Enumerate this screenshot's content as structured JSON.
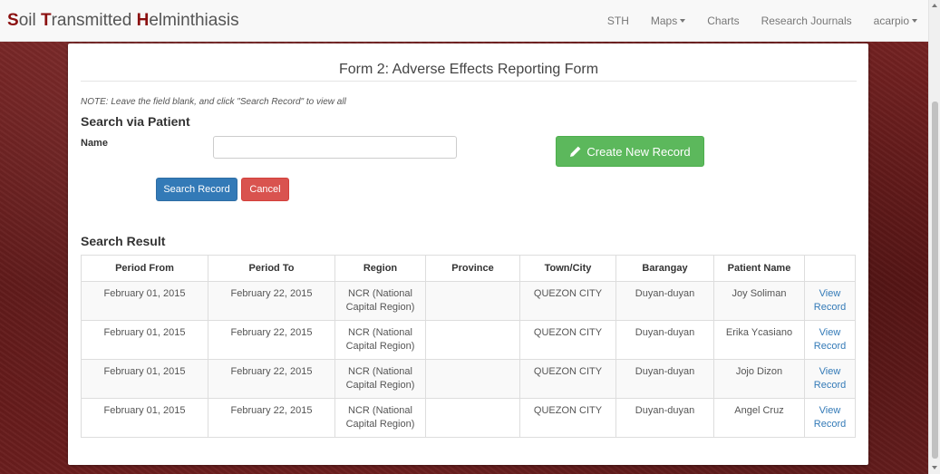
{
  "brand": {
    "parts": [
      {
        "cap": "S",
        "rest": "oil "
      },
      {
        "cap": "T",
        "rest": "ransmitted "
      },
      {
        "cap": "H",
        "rest": "elminthiasis"
      }
    ]
  },
  "nav": [
    {
      "label": "STH",
      "dropdown": false
    },
    {
      "label": "Maps",
      "dropdown": true
    },
    {
      "label": "Charts",
      "dropdown": false
    },
    {
      "label": "Research Journals",
      "dropdown": false
    },
    {
      "label": "acarpio",
      "dropdown": true
    }
  ],
  "form": {
    "title": "Form 2: Adverse Effects Reporting Form",
    "note": "NOTE: Leave the field blank, and click \"Search Record\" to view all",
    "search_heading": "Search via Patient",
    "name_label": "Name",
    "name_value": "",
    "create_label": "Create New Record",
    "search_label": "Search Record",
    "cancel_label": "Cancel"
  },
  "results": {
    "heading": "Search Result",
    "columns": [
      "Period From",
      "Period To",
      "Region",
      "Province",
      "Town/City",
      "Barangay",
      "Patient Name",
      ""
    ],
    "rows": [
      {
        "from": "February 01, 2015",
        "to": "February 22, 2015",
        "region1": "NCR (National",
        "region2": "Capital Region)",
        "province": "",
        "city": "QUEZON CITY",
        "barangay": "Duyan-duyan",
        "patient": "Joy Soliman",
        "view1": "View",
        "view2": "Record"
      },
      {
        "from": "February 01, 2015",
        "to": "February 22, 2015",
        "region1": "NCR (National",
        "region2": "Capital Region)",
        "province": "",
        "city": "QUEZON CITY",
        "barangay": "Duyan-duyan",
        "patient": "Erika Ycasiano",
        "view1": "View",
        "view2": "Record"
      },
      {
        "from": "February 01, 2015",
        "to": "February 22, 2015",
        "region1": "NCR (National",
        "region2": "Capital Region)",
        "province": "",
        "city": "QUEZON CITY",
        "barangay": "Duyan-duyan",
        "patient": "Jojo Dizon",
        "view1": "View",
        "view2": "Record"
      },
      {
        "from": "February 01, 2015",
        "to": "February 22, 2015",
        "region1": "NCR (National",
        "region2": "Capital Region)",
        "province": "",
        "city": "QUEZON CITY",
        "barangay": "Duyan-duyan",
        "patient": "Angel Cruz",
        "view1": "View",
        "view2": "Record"
      }
    ]
  },
  "colors": {
    "brand_accent": "#8b1010",
    "success": "#5cb85c",
    "primary": "#337ab7",
    "danger": "#d9534f"
  },
  "icons": {
    "create": "pencil-icon",
    "dropdown": "caret-down-icon"
  }
}
